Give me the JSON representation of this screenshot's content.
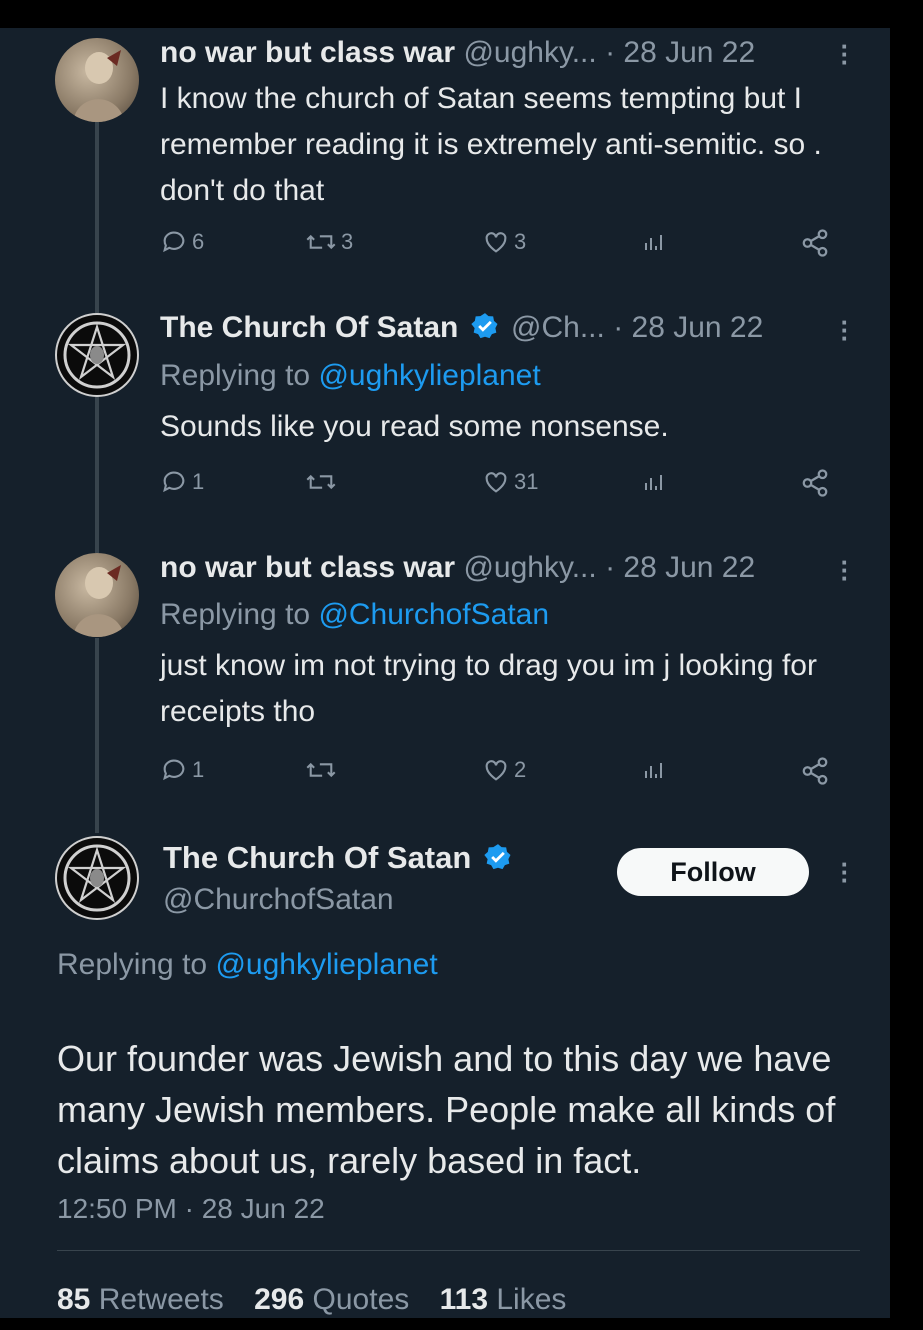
{
  "tweets": [
    {
      "name": "no war but class war",
      "handle": "@ughky...",
      "date": "· 28 Jun 22",
      "text": "I know the church of Satan seems tempting but I remember reading it is extremely anti-semitic. so . don't do that",
      "replies": "6",
      "retweets": "3",
      "likes": "3"
    },
    {
      "name": "The Church Of Satan",
      "handle": "@Ch...",
      "date": "· 28 Jun 22",
      "replying_prefix": "Replying to",
      "replying_to": "@ughkylieplanet",
      "text": "Sounds like you read some nonsense.",
      "replies": "1",
      "retweets": "",
      "likes": "31"
    },
    {
      "name": "no war but class war",
      "handle": "@ughky...",
      "date": "· 28 Jun 22",
      "replying_prefix": "Replying to",
      "replying_to": "@ChurchofSatan",
      "text": "just know im not trying to drag you im j looking for receipts tho",
      "replies": "1",
      "retweets": "",
      "likes": "2"
    }
  ],
  "main_tweet": {
    "name": "The Church Of Satan",
    "handle": "@ChurchofSatan",
    "follow_label": "Follow",
    "replying_prefix": "Replying to",
    "replying_to": "@ughkylieplanet",
    "text": "Our founder was Jewish and to this day we have many Jewish members. People make all kinds of claims about us, rarely based in fact.",
    "timestamp": "12:50 PM · 28 Jun 22",
    "stats": {
      "retweets_count": "85",
      "retweets_label": "Retweets",
      "quotes_count": "296",
      "quotes_label": "Quotes",
      "likes_count": "113",
      "likes_label": "Likes"
    }
  },
  "icons": {
    "reply": "reply-icon",
    "retweet": "retweet-icon",
    "like": "heart-icon",
    "views": "views-icon",
    "share": "share-icon",
    "verified": "verified-badge-icon",
    "more": "more-icon"
  },
  "colors": {
    "background": "#15202b",
    "text": "#e7e9ea",
    "muted": "#8b98a5",
    "link": "#1d9bf0",
    "divider": "#38444d"
  }
}
